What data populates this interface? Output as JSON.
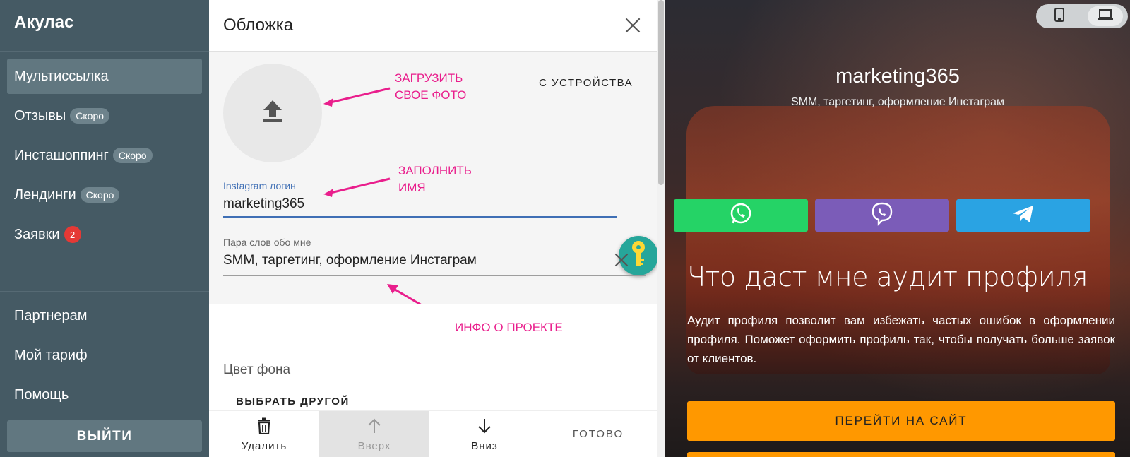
{
  "sidebar": {
    "brand": "Акулас",
    "items": [
      {
        "label": "Мультиссылка",
        "active": true
      },
      {
        "label": "Отзывы",
        "badge": "Скоро"
      },
      {
        "label": "Инсташоппинг",
        "badge": "Скоро"
      },
      {
        "label": "Лендинги",
        "badge": "Скоро"
      },
      {
        "label": "Заявки",
        "count": "2"
      }
    ],
    "bottom_items": [
      {
        "label": "Партнерам"
      },
      {
        "label": "Мой тариф"
      },
      {
        "label": "Помощь"
      }
    ],
    "logout_label": "ВЫЙТИ"
  },
  "editor": {
    "title": "Обложка",
    "close_icon": "close-icon",
    "upload_icon": "upload-icon",
    "from_device_label": "С УСТРОЙСТВА",
    "annotations": {
      "upload": [
        "ЗАГРУЗИТЬ",
        "СВОЕ ФОТО"
      ],
      "name": [
        "ЗАПОЛНИТЬ",
        "ИМЯ"
      ],
      "info": "ИНФО О ПРОЕКТЕ"
    },
    "instagram_field": {
      "label": "Instagram логин",
      "value": "marketing365"
    },
    "about_field": {
      "label": "Пара слов обо мне",
      "value": "SMM, таргетинг, оформление Инстаграм"
    },
    "background_color_label": "Цвет фона",
    "choose_other_label": "ВЫБРАТЬ ДРУГОЙ",
    "toolbar": {
      "delete_label": "Удалить",
      "up_label": "Вверх",
      "down_label": "Вниз",
      "done_label": "ГОТОВО"
    }
  },
  "preview": {
    "device_switch": [
      "mobile-icon",
      "laptop-icon"
    ],
    "title": "marketing365",
    "subtitle": "SMM, таргетинг, оформление Инстаграм",
    "social_buttons": [
      {
        "name": "whatsapp",
        "color": "#25d366"
      },
      {
        "name": "viber",
        "color": "#7b5cb8"
      },
      {
        "name": "telegram",
        "color": "#2aa3e3"
      }
    ],
    "heading": "Что даст мне аудит профиля",
    "text": "Аудит профиля позволит вам избежать частых ошибок в оформлении профиля. Поможет оформить профиль так, чтобы получать больше заявок от клиентов.",
    "cta_label": "ПЕРЕЙТИ НА САЙТ"
  },
  "colors": {
    "sidebar_bg": "#455a64",
    "accent_annotation": "#e91e8c",
    "field_focus": "#3f6fb5",
    "fab": "#26a69a",
    "cta": "#ff9800"
  }
}
